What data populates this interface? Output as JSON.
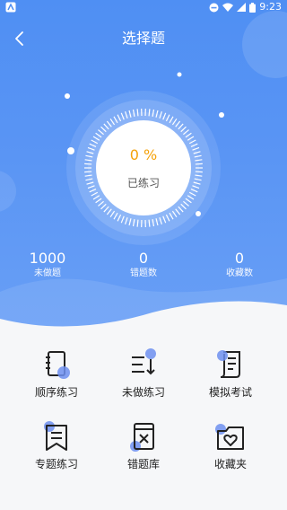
{
  "status_bar": {
    "time": "9:23"
  },
  "header": {
    "title": "选择题",
    "back_icon": "chevron-left-icon"
  },
  "progress": {
    "percent_text": "0 %",
    "label": "已练习",
    "value": 0
  },
  "stats": [
    {
      "value": "1000",
      "label": "未做题"
    },
    {
      "value": "0",
      "label": "错题数"
    },
    {
      "value": "0",
      "label": "收藏数"
    }
  ],
  "menu": [
    {
      "label": "顺序练习",
      "icon": "notebook-icon"
    },
    {
      "label": "未做练习",
      "icon": "list-sort-icon"
    },
    {
      "label": "模拟考试",
      "icon": "exam-paper-icon"
    },
    {
      "label": "专题练习",
      "icon": "bookmark-icon"
    },
    {
      "label": "错题库",
      "icon": "wrong-book-icon"
    },
    {
      "label": "收藏夹",
      "icon": "favorites-folder-icon"
    }
  ],
  "colors": {
    "primary": "#4f8ff3",
    "accent": "#f5a20a",
    "icon_dot": "#6d8ff0"
  }
}
